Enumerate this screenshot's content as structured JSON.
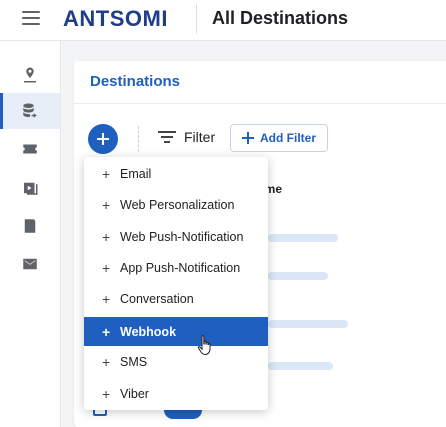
{
  "header": {
    "logo": "ANTSOMI",
    "title": "All Destinations"
  },
  "card": {
    "title": "Destinations"
  },
  "toolbar": {
    "filter_label": "Filter",
    "add_filter_label": "Add Filter"
  },
  "table": {
    "name_header": "ame"
  },
  "menu": {
    "items": [
      {
        "label": "Email"
      },
      {
        "label": "Web Personalization"
      },
      {
        "label": "Web Push-Notification"
      },
      {
        "label": "App Push-Notification"
      },
      {
        "label": "Conversation"
      },
      {
        "label": "Webhook"
      },
      {
        "label": "SMS"
      },
      {
        "label": "Viber"
      }
    ],
    "selected": "Webhook"
  },
  "colors": {
    "primary": "#1f5fbf",
    "brand": "#1f3e8a"
  },
  "icons": {
    "sidebar": [
      "journey-icon",
      "destinations-icon",
      "ticket-icon",
      "media-icon",
      "document-icon",
      "mail-icon"
    ]
  }
}
